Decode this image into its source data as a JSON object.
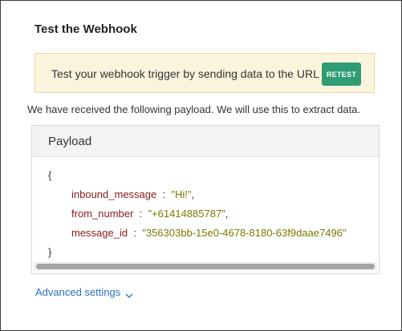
{
  "panel": {
    "title": "Test the Webhook"
  },
  "notice": {
    "text": "Test your webhook trigger by sending data to the URL",
    "retest_label": "RETEST"
  },
  "received": {
    "text": "We have received the following payload. We will use this to extract data."
  },
  "payload": {
    "title": "Payload",
    "open_brace": "{",
    "close_brace": "}",
    "fields": [
      {
        "key": "inbound_message",
        "value": "\"Hi!\"",
        "trail": ","
      },
      {
        "key": "from_number",
        "value": "\"+61414885787\"",
        "trail": ","
      },
      {
        "key": "message_id",
        "value": "\"356303bb-15e0-4678-8180-63f9daae7496\"",
        "trail": ""
      }
    ],
    "separator": ":"
  },
  "advanced": {
    "label": "Advanced settings",
    "icon": "chevron-down-icon"
  },
  "colors": {
    "notice_bg": "#fbf4dd",
    "retest_bg": "#2f9c74",
    "link": "#2a71c0",
    "key": "#8b1a1a",
    "value": "#7a7a00"
  }
}
